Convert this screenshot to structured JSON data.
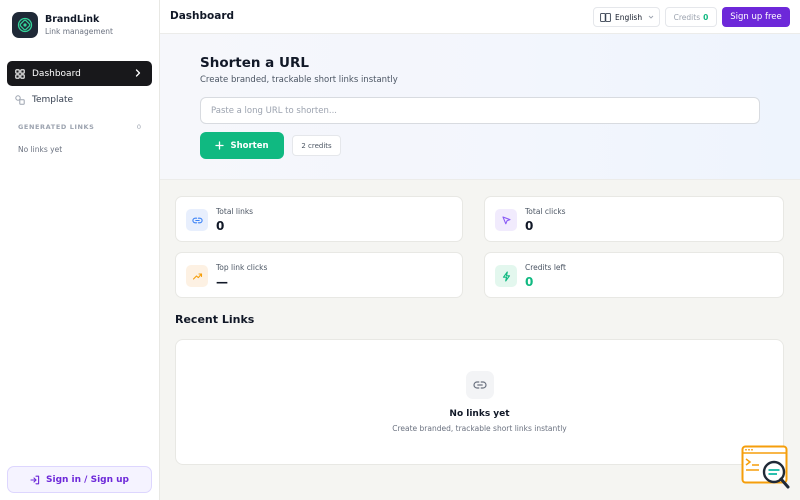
{
  "brand": {
    "name": "BrandLink",
    "subtitle": "Link management"
  },
  "sidebar": {
    "items": [
      {
        "label": "Dashboard",
        "active": true
      },
      {
        "label": "Template",
        "active": false
      }
    ],
    "generated_header": "GENERATED LINKS",
    "generated_count": "0",
    "empty_text": "No links yet",
    "signin_label": "Sign in / Sign up"
  },
  "header": {
    "title": "Dashboard",
    "language": "English",
    "credits_label": "Credits",
    "credits_value": "0",
    "signup_label": "Sign up free"
  },
  "hero": {
    "title": "Shorten a URL",
    "subtitle": "Create branded, trackable short links instantly",
    "input_placeholder": "Paste a long URL to shorten...",
    "input_value": "",
    "button_label": "Shorten",
    "credits_badge": "2 credits"
  },
  "stats": [
    {
      "label": "Total links",
      "value": "0",
      "icon": "link-icon"
    },
    {
      "label": "Total clicks",
      "value": "0",
      "icon": "cursor-click-icon"
    },
    {
      "label": "Top link clicks",
      "value": "—",
      "icon": "trending-up-icon"
    },
    {
      "label": "Credits left",
      "value": "0",
      "icon": "lightning-icon"
    }
  ],
  "recent": {
    "title": "Recent Links",
    "empty_title": "No links yet",
    "empty_subtitle": "Create branded, trackable short links instantly"
  },
  "colors": {
    "accent_purple": "#6d28d9",
    "accent_green": "#10b981",
    "sidebar_active": "#18181b"
  }
}
